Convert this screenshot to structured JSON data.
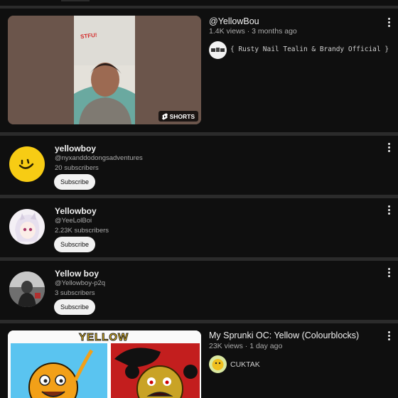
{
  "results": [
    {
      "type": "short",
      "title": "@YellowBou",
      "views": "1.4K views",
      "age": "3 months ago",
      "channel": "{ Rusty Nail Tealin & Brandy Official }",
      "badge": "SHORTS",
      "overlay_text": "STFU!"
    },
    {
      "type": "channel",
      "name": "yellowboy",
      "handle": "@nyxanddodongsadventures",
      "subscribers": "20 subscribers",
      "subscribe_label": "Subscribe"
    },
    {
      "type": "channel",
      "name": "Yellowboy",
      "handle": "@YeeLolBoi",
      "subscribers": "2.23K subscribers",
      "subscribe_label": "Subscribe"
    },
    {
      "type": "channel",
      "name": "Yellow boy",
      "handle": "@Yellowboy-p2q",
      "subscribers": "3 subscribers",
      "subscribe_label": "Subscribe"
    },
    {
      "type": "video",
      "title": "My Sprunki OC: Yellow (Colourblocks)",
      "views": "23K views",
      "age": "1 day ago",
      "channel": "CUKTAK",
      "thumb_text": "YELLOW"
    }
  ],
  "icons": {
    "menu": "more-vert-icon",
    "shorts": "shorts-logo-icon"
  },
  "colors": {
    "background": "#0f0f0f",
    "divider": "#2b2b2b",
    "meta_text": "#aaaaaa",
    "subscribe_bg": "#f1f1f1"
  }
}
